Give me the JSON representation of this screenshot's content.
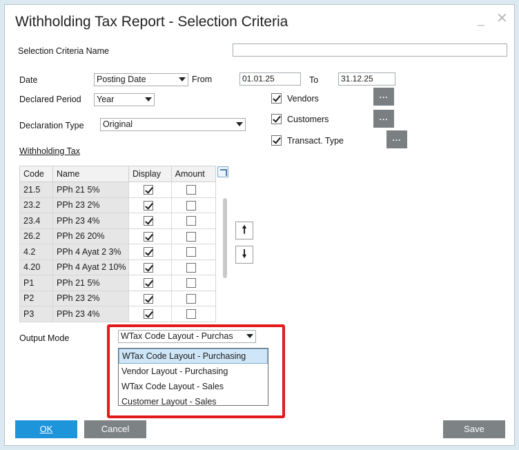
{
  "window": {
    "title": "Withholding Tax Report - Selection Criteria",
    "minimize_glyph": "_",
    "close_glyph": "✕"
  },
  "criteria_name": {
    "label": "Selection Criteria Name",
    "value": ""
  },
  "date": {
    "label": "Date",
    "type_value": "Posting Date",
    "from_label": "From",
    "from_value": "01.01.25",
    "to_label": "To",
    "to_value": "31.12.25"
  },
  "declared_period": {
    "label": "Declared Period",
    "value": "Year"
  },
  "declaration_type": {
    "label": "Declaration Type",
    "value": "Original"
  },
  "bp_filters": [
    {
      "label": "Vendors",
      "checked": true,
      "button": "..."
    },
    {
      "label": "Customers",
      "checked": true,
      "button": "..."
    },
    {
      "label": "Transact. Type",
      "checked": true,
      "button": "..."
    }
  ],
  "withholding_tax": {
    "section_label": "Withholding Tax",
    "columns": [
      "Code",
      "Name",
      "Display",
      "Amount"
    ],
    "rows": [
      {
        "code": "21.5",
        "name": "PPh 21 5%",
        "display": true,
        "amount": false
      },
      {
        "code": "23.2",
        "name": "PPh 23 2%",
        "display": true,
        "amount": false
      },
      {
        "code": "23.4",
        "name": "PPh 23 4%",
        "display": true,
        "amount": false
      },
      {
        "code": "26.2",
        "name": "PPh 26 20%",
        "display": true,
        "amount": false
      },
      {
        "code": "4.2",
        "name": "PPh 4 Ayat 2 3%",
        "display": true,
        "amount": false
      },
      {
        "code": "4.20",
        "name": "PPh 4 Ayat 2 10%",
        "display": true,
        "amount": false
      },
      {
        "code": "P1",
        "name": "PPh 21 5%",
        "display": true,
        "amount": false
      },
      {
        "code": "P2",
        "name": "PPh 23 2%",
        "display": true,
        "amount": false
      },
      {
        "code": "P3",
        "name": "PPh 23 4%",
        "display": true,
        "amount": false
      }
    ],
    "move_up_glyph": "🠕",
    "move_down_glyph": "🠗"
  },
  "output_mode": {
    "label": "Output Mode",
    "value": "WTax Code Layout - Purchas",
    "options": [
      "WTax Code Layout - Purchasing",
      "Vendor Layout - Purchasing",
      "WTax Code Layout - Sales",
      "Customer Layout - Sales"
    ],
    "selected_index": 0
  },
  "buttons": {
    "ok": "OK",
    "cancel": "Cancel",
    "save": "Save"
  },
  "colors": {
    "accent": "#1e94db",
    "highlight": "#e21a1a",
    "button_gray": "#7d8285"
  }
}
